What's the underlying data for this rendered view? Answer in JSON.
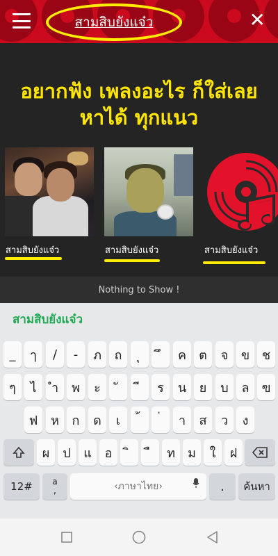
{
  "header": {
    "title": "สามสิบยังแจ๋ว",
    "menu_icon": "hamburger-menu-icon",
    "close_icon": "close-icon",
    "bg_color": "#cc0a1e",
    "highlight_color": "#ffec00"
  },
  "main": {
    "headline_line1": "อยากฟัง เพลงอะไร ก็ใส่เลย",
    "headline_line2": "หาได้ ทุกแนว",
    "headline_color": "#ffe600",
    "results": [
      {
        "label": "สามสิบยังแจ๋ว",
        "thumb": "couple-photo"
      },
      {
        "label": "สามสิบยังแจ๋ว",
        "thumb": "webcam-photo"
      },
      {
        "label": "สามสิบยังแจ๋ว",
        "thumb": "music-disc-logo-icon"
      }
    ],
    "empty_message": "Nothing to Show !"
  },
  "keyboard": {
    "suggestion": "สามสิบยังแจ๋ว",
    "suggestion_color": "#1faa52",
    "row1": [
      "_",
      "ๅ",
      "/",
      "-",
      "ภ",
      "ถ",
      "ุ",
      "ึ",
      "ค",
      "ต",
      "จ",
      "ข",
      "ช"
    ],
    "row2": [
      "ๆ",
      "ไ",
      "ำ",
      "พ",
      "ะ",
      "ั",
      "ี",
      "ร",
      "น",
      "ย",
      "บ",
      "ล",
      "ฃ"
    ],
    "row3": [
      "ฟ",
      "ห",
      "ก",
      "ด",
      "เ",
      "้",
      "่",
      "า",
      "ส",
      "ว",
      "ง"
    ],
    "row4": [
      "ผ",
      "ป",
      "แ",
      "อ",
      "ิ",
      "ื",
      "ท",
      "ม",
      "ใ",
      "ฝ"
    ],
    "shift_icon": "shift-icon",
    "backspace_icon": "backspace-icon",
    "numbers_key": "12#",
    "symbol_key_top": "a",
    "symbol_key_bottom": ",",
    "space_label": "ภาษาไทย",
    "mic_icon": "microphone-icon",
    "period_key": ".",
    "search_key": "ค้นหา"
  },
  "navbar": {
    "recents_icon": "recents-square-icon",
    "home_icon": "home-circle-icon",
    "back_icon": "back-triangle-icon"
  }
}
